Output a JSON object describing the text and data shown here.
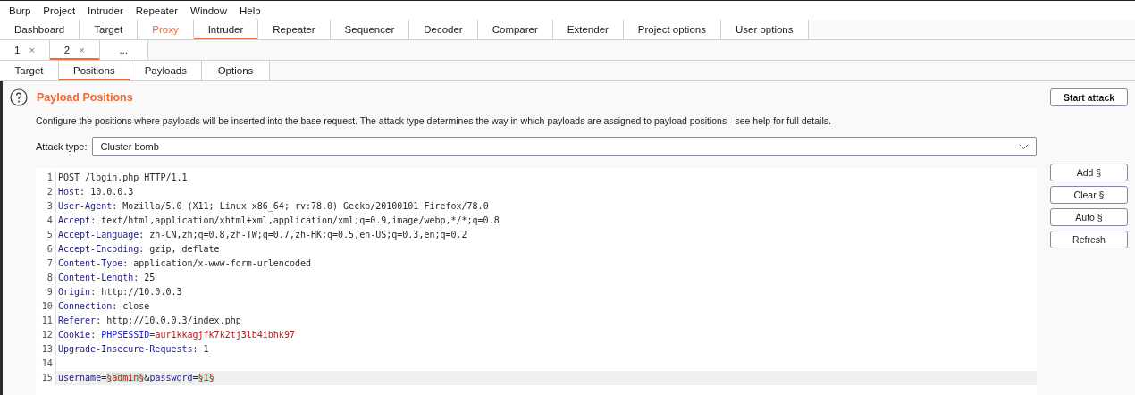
{
  "menu": [
    "Burp",
    "Project",
    "Intruder",
    "Repeater",
    "Window",
    "Help"
  ],
  "main_tabs": [
    {
      "label": "Dashboard",
      "selected": false,
      "highlighted": false
    },
    {
      "label": "Target",
      "selected": false,
      "highlighted": false
    },
    {
      "label": "Proxy",
      "selected": false,
      "highlighted": true
    },
    {
      "label": "Intruder",
      "selected": true,
      "highlighted": false
    },
    {
      "label": "Repeater",
      "selected": false,
      "highlighted": false
    },
    {
      "label": "Sequencer",
      "selected": false,
      "highlighted": false
    },
    {
      "label": "Decoder",
      "selected": false,
      "highlighted": false
    },
    {
      "label": "Comparer",
      "selected": false,
      "highlighted": false
    },
    {
      "label": "Extender",
      "selected": false,
      "highlighted": false
    },
    {
      "label": "Project options",
      "selected": false,
      "highlighted": false
    },
    {
      "label": "User options",
      "selected": false,
      "highlighted": false
    }
  ],
  "attack_tabs": [
    {
      "label": "1",
      "close": "×",
      "selected": false
    },
    {
      "label": "2",
      "close": "×",
      "selected": true
    },
    {
      "label": "...",
      "selected": false
    }
  ],
  "sub_tabs": [
    {
      "label": "Target",
      "selected": false
    },
    {
      "label": "Positions",
      "selected": true
    },
    {
      "label": "Payloads",
      "selected": false
    },
    {
      "label": "Options",
      "selected": false
    }
  ],
  "section": {
    "title": "Payload Positions",
    "description": "Configure the positions where payloads will be inserted into the base request. The attack type determines the way in which payloads are assigned to payload positions - see help for full details.",
    "start_button": "Start attack"
  },
  "attack_type": {
    "label": "Attack type:",
    "value": "Cluster bomb"
  },
  "request": [
    {
      "number": "1",
      "current": false,
      "tokens": [
        {
          "kind": "text",
          "text": "POST /login.php HTTP/1.1"
        }
      ]
    },
    {
      "number": "2",
      "current": false,
      "tokens": [
        {
          "kind": "name",
          "text": "Host"
        },
        {
          "kind": "text",
          "text": ": 10.0.0.3"
        }
      ]
    },
    {
      "number": "3",
      "current": false,
      "tokens": [
        {
          "kind": "name",
          "text": "User-Agent"
        },
        {
          "kind": "text",
          "text": ": Mozilla/5.0 (X11; Linux x86_64; rv:78.0) Gecko/20100101 Firefox/78.0"
        }
      ]
    },
    {
      "number": "4",
      "current": false,
      "tokens": [
        {
          "kind": "name",
          "text": "Accept"
        },
        {
          "kind": "text",
          "text": ": text/html,application/xhtml+xml,application/xml;q=0.9,image/webp,*/*;q=0.8"
        }
      ]
    },
    {
      "number": "5",
      "current": false,
      "tokens": [
        {
          "kind": "name",
          "text": "Accept-Language"
        },
        {
          "kind": "text",
          "text": ": zh-CN,zh;q=0.8,zh-TW;q=0.7,zh-HK;q=0.5,en-US;q=0.3,en;q=0.2"
        }
      ]
    },
    {
      "number": "6",
      "current": false,
      "tokens": [
        {
          "kind": "name",
          "text": "Accept-Encoding"
        },
        {
          "kind": "text",
          "text": ": gzip, deflate"
        }
      ]
    },
    {
      "number": "7",
      "current": false,
      "tokens": [
        {
          "kind": "name",
          "text": "Content-Type"
        },
        {
          "kind": "text",
          "text": ": application/x-www-form-urlencoded"
        }
      ]
    },
    {
      "number": "8",
      "current": false,
      "tokens": [
        {
          "kind": "name",
          "text": "Content-Length"
        },
        {
          "kind": "text",
          "text": ": 25"
        }
      ]
    },
    {
      "number": "9",
      "current": false,
      "tokens": [
        {
          "kind": "name",
          "text": "Origin"
        },
        {
          "kind": "text",
          "text": ": http://10.0.0.3"
        }
      ]
    },
    {
      "number": "10",
      "current": false,
      "tokens": [
        {
          "kind": "name",
          "text": "Connection"
        },
        {
          "kind": "text",
          "text": ": close"
        }
      ]
    },
    {
      "number": "11",
      "current": false,
      "tokens": [
        {
          "kind": "name",
          "text": "Referer"
        },
        {
          "kind": "text",
          "text": ": http://10.0.0.3/index.php"
        }
      ]
    },
    {
      "number": "12",
      "current": false,
      "tokens": [
        {
          "kind": "name",
          "text": "Cookie"
        },
        {
          "kind": "text",
          "text": ": "
        },
        {
          "kind": "param",
          "text": "PHPSESSID"
        },
        {
          "kind": "cookie",
          "text": "="
        },
        {
          "kind": "value",
          "text": "aur1kkagjfk7k2tj3lb4ibhk97"
        }
      ]
    },
    {
      "number": "13",
      "current": false,
      "tokens": [
        {
          "kind": "name",
          "text": "Upgrade-Insecure-Requests"
        },
        {
          "kind": "text",
          "text": ": 1"
        }
      ]
    },
    {
      "number": "14",
      "current": false
    },
    {
      "number": "15",
      "current": true,
      "tokens": [
        {
          "kind": "name",
          "text": "username"
        },
        {
          "kind": "text",
          "text": "="
        },
        {
          "kind": "payload",
          "text": "§admin§"
        },
        {
          "kind": "text",
          "text": "&"
        },
        {
          "kind": "name",
          "text": "password"
        },
        {
          "kind": "text",
          "text": "="
        },
        {
          "kind": "payload",
          "text": "§1§"
        }
      ]
    }
  ],
  "side_buttons": [
    "Add §",
    "Clear §",
    "Auto §",
    "Refresh"
  ]
}
